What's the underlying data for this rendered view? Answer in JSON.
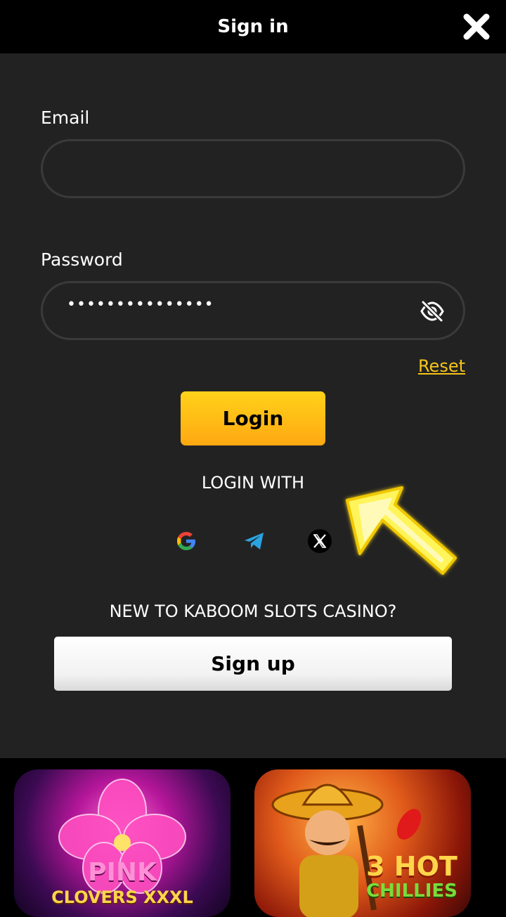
{
  "header": {
    "title": "Sign in"
  },
  "form": {
    "email_label": "Email",
    "email_value": "",
    "password_label": "Password",
    "password_value": "•••••••••••••••",
    "reset_label": "Reset",
    "login_label": "Login",
    "login_with_label": "LOGIN WITH",
    "social": [
      "google-icon",
      "telegram-icon",
      "x-icon"
    ]
  },
  "signup": {
    "prompt": "NEW TO KABOOM SLOTS CASINO?",
    "button_label": "Sign up"
  },
  "games": [
    {
      "title_line1": "PINK",
      "title_line2": "CLOVERS XXXL"
    },
    {
      "title_line1": "3 HOT",
      "title_line2": "CHILLIES"
    }
  ],
  "colors": {
    "accent": "#f5c518",
    "login_gradient_top": "#ffd21a",
    "login_gradient_bottom": "#ffa812",
    "panel_bg": "#222223"
  }
}
